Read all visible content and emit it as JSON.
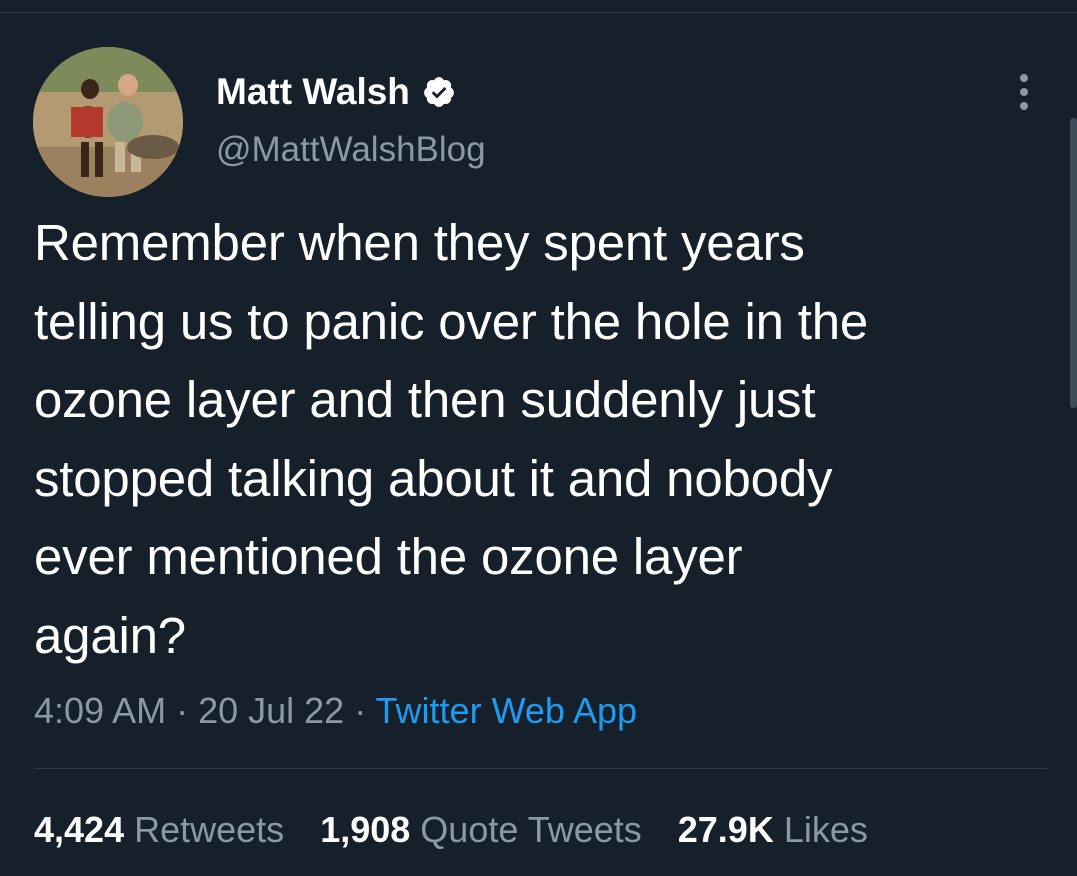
{
  "author": {
    "display_name": "Matt Walsh",
    "handle": "@MattWalshBlog",
    "verified": true,
    "avatar_icon": "profile-photo"
  },
  "tweet": {
    "text": "Remember when they spent years\ntelling us to panic over the hole in the\nozone layer and then suddenly just\nstopped talking about it and nobody\never mentioned the ozone layer\nagain?"
  },
  "meta": {
    "time": "4:09 AM",
    "separator": " · ",
    "date": "20 Jul 22",
    "source": "Twitter Web App"
  },
  "stats": {
    "retweets_count": "4,424",
    "retweets_label": "Retweets",
    "quote_tweets_count": "1,908",
    "quote_tweets_label": "Quote Tweets",
    "likes_count": "27.9K",
    "likes_label": "Likes"
  },
  "colors": {
    "background": "#15202b",
    "primary_text": "#ffffff",
    "secondary_text": "#8b98a5",
    "link": "#1d9bf0",
    "divider": "#2f3b47"
  }
}
